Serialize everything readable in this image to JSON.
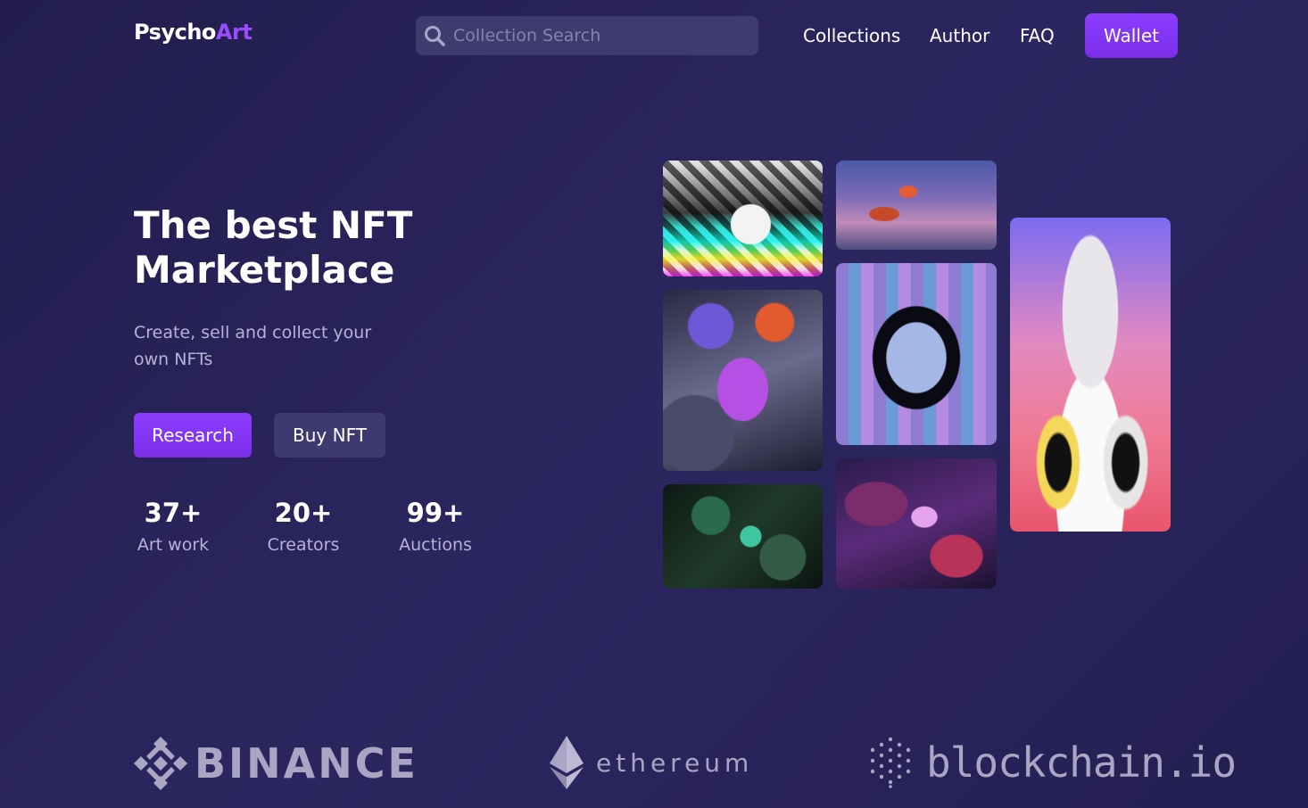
{
  "logo": {
    "part1": "Psycho",
    "part2": "Art"
  },
  "search": {
    "placeholder": "Collection Search",
    "icon": "search-icon"
  },
  "nav": {
    "links": [
      "Collections",
      "Author",
      "FAQ"
    ],
    "wallet_label": "Wallet"
  },
  "hero": {
    "headline_line1": "The best NFT",
    "headline_line2": "Marketplace",
    "subtitle_line1": "Create, sell and collect your",
    "subtitle_line2": "own NFTs",
    "primary_button": "Research",
    "secondary_button": "Buy NFT"
  },
  "stats": [
    {
      "value": "37+",
      "label": "Art work"
    },
    {
      "value": "20+",
      "label": "Creators"
    },
    {
      "value": "99+",
      "label": "Auctions"
    }
  ],
  "partners": {
    "binance": "BINANCE",
    "ethereum": "ethereum",
    "blockchain": "blockchain.io"
  },
  "colors": {
    "background": "#2a2560",
    "accent": "#8b3dff",
    "search_bg": "#403b6e",
    "muted_text": "#b7b2d6",
    "partner_text": "#a9a5c2"
  }
}
